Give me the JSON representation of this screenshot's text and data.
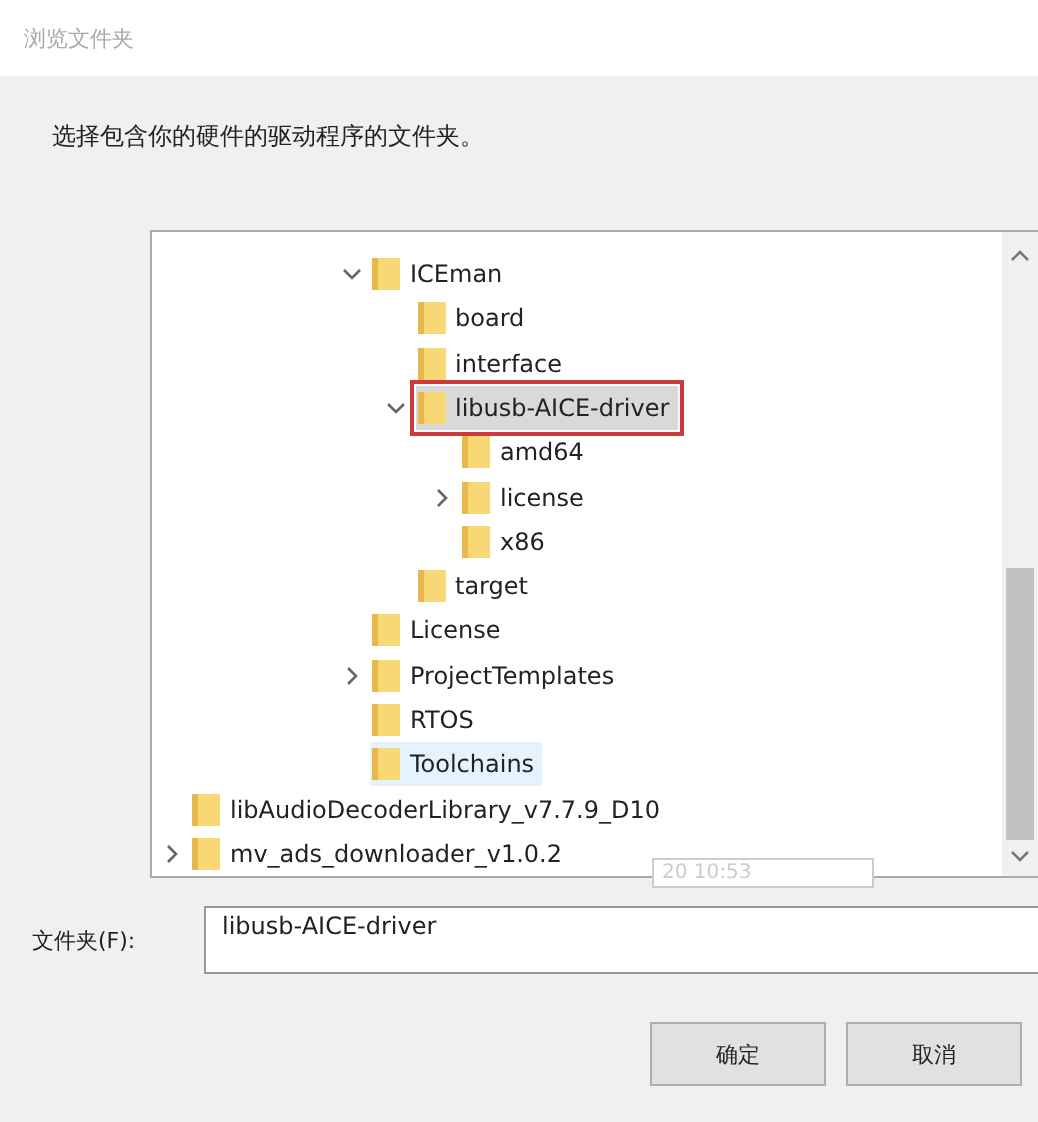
{
  "window": {
    "title": "浏览文件夹"
  },
  "instruction": "选择包含你的硬件的驱动程序的文件夹。",
  "tree": {
    "scrolled_items": [
      {
        "label": "ICEman",
        "expanded": true,
        "selected": false,
        "hovered": false,
        "marked": false,
        "children": [
          {
            "label": "board",
            "selected": false,
            "hovered": false,
            "marked": false
          },
          {
            "label": "interface",
            "selected": false,
            "hovered": false,
            "marked": false
          },
          {
            "label": "libusb-AICE-driver",
            "expanded": true,
            "selected": true,
            "hovered": false,
            "marked": true,
            "children": [
              {
                "label": "amd64",
                "selected": false,
                "hovered": false,
                "marked": false
              },
              {
                "label": "license",
                "expanded": false,
                "selected": false,
                "hovered": false,
                "marked": false
              },
              {
                "label": "x86",
                "selected": false,
                "hovered": false,
                "marked": false
              }
            ]
          },
          {
            "label": "target",
            "selected": false,
            "hovered": false,
            "marked": false
          }
        ]
      },
      {
        "label": "License",
        "selected": false,
        "hovered": false,
        "marked": false
      },
      {
        "label": "ProjectTemplates",
        "expanded": false,
        "selected": false,
        "hovered": false,
        "marked": false
      },
      {
        "label": "RTOS",
        "selected": false,
        "hovered": false,
        "marked": false
      },
      {
        "label": "Toolchains",
        "selected": false,
        "hovered": true,
        "marked": false
      }
    ],
    "items": [
      {
        "label": "libAudioDecoderLibrary_v7.7.9_D10",
        "selected": false,
        "hovered": false,
        "marked": false
      },
      {
        "label": "mv_ads_downloader_v1.0.2",
        "expanded": false,
        "selected": false,
        "hovered": false,
        "marked": false
      }
    ],
    "tooltip": "20 10:53"
  },
  "folder_field": {
    "label": "文件夹(F):",
    "value": "libusb-AICE-driver"
  },
  "buttons": [
    "确定",
    "取消"
  ]
}
